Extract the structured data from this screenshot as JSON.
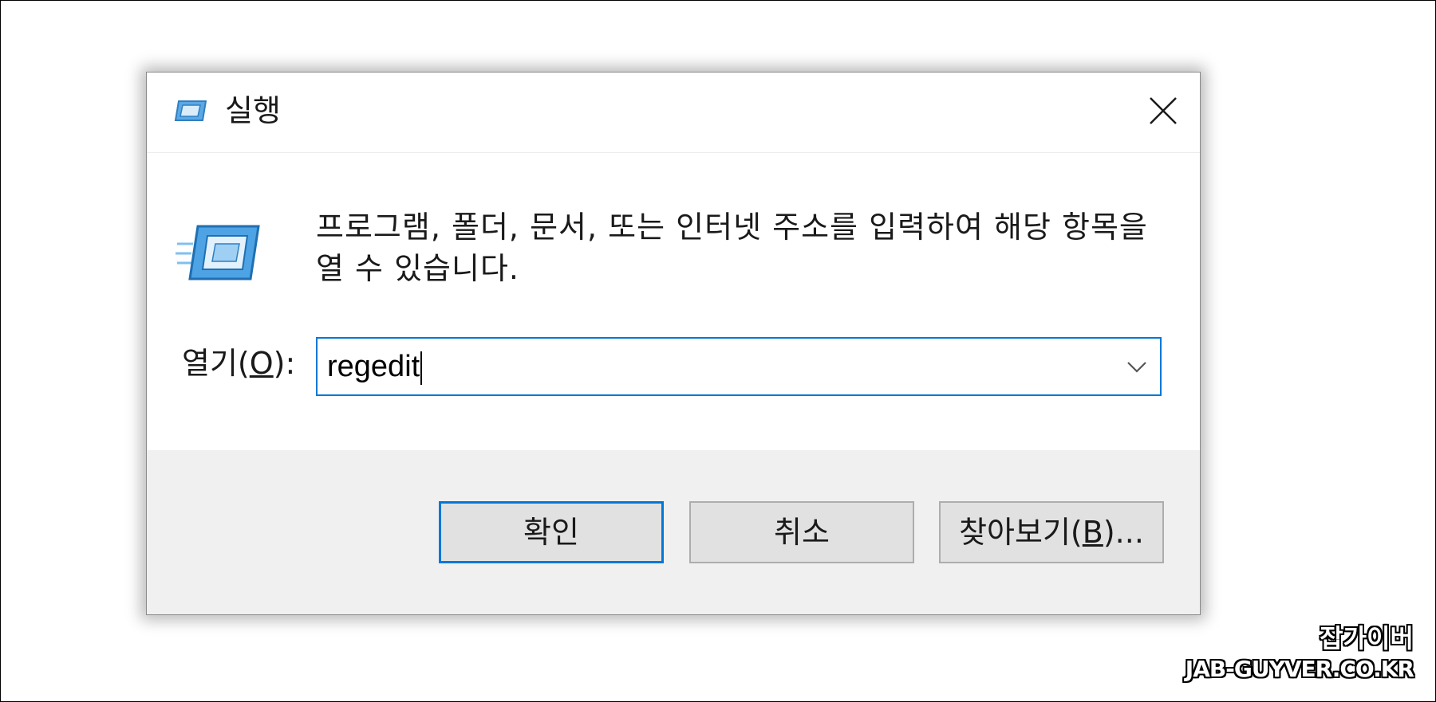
{
  "window": {
    "title": "실행",
    "title_icon": "run-icon",
    "close_icon": "close-icon"
  },
  "main": {
    "icon": "run-icon",
    "description": "프로그램, 폴더, 문서, 또는 인터넷 주소를 입력하여 해당 항목을 열 수 있습니다."
  },
  "open_field": {
    "label_prefix": "열기(",
    "label_accel": "O",
    "label_suffix": "):",
    "value": "regedit",
    "dropdown_icon": "chevron-down-icon"
  },
  "buttons": {
    "ok_label": "확인",
    "cancel_label": "취소",
    "browse_prefix": "찾아보기(",
    "browse_accel": "B",
    "browse_suffix": ")..."
  },
  "watermark": {
    "line1": "잡가이버",
    "line2": "JAB-GUYVER.CO.KR"
  },
  "colors": {
    "accent": "#0078d7",
    "button_area": "#f0f0f0",
    "button_face": "#e1e1e1"
  }
}
